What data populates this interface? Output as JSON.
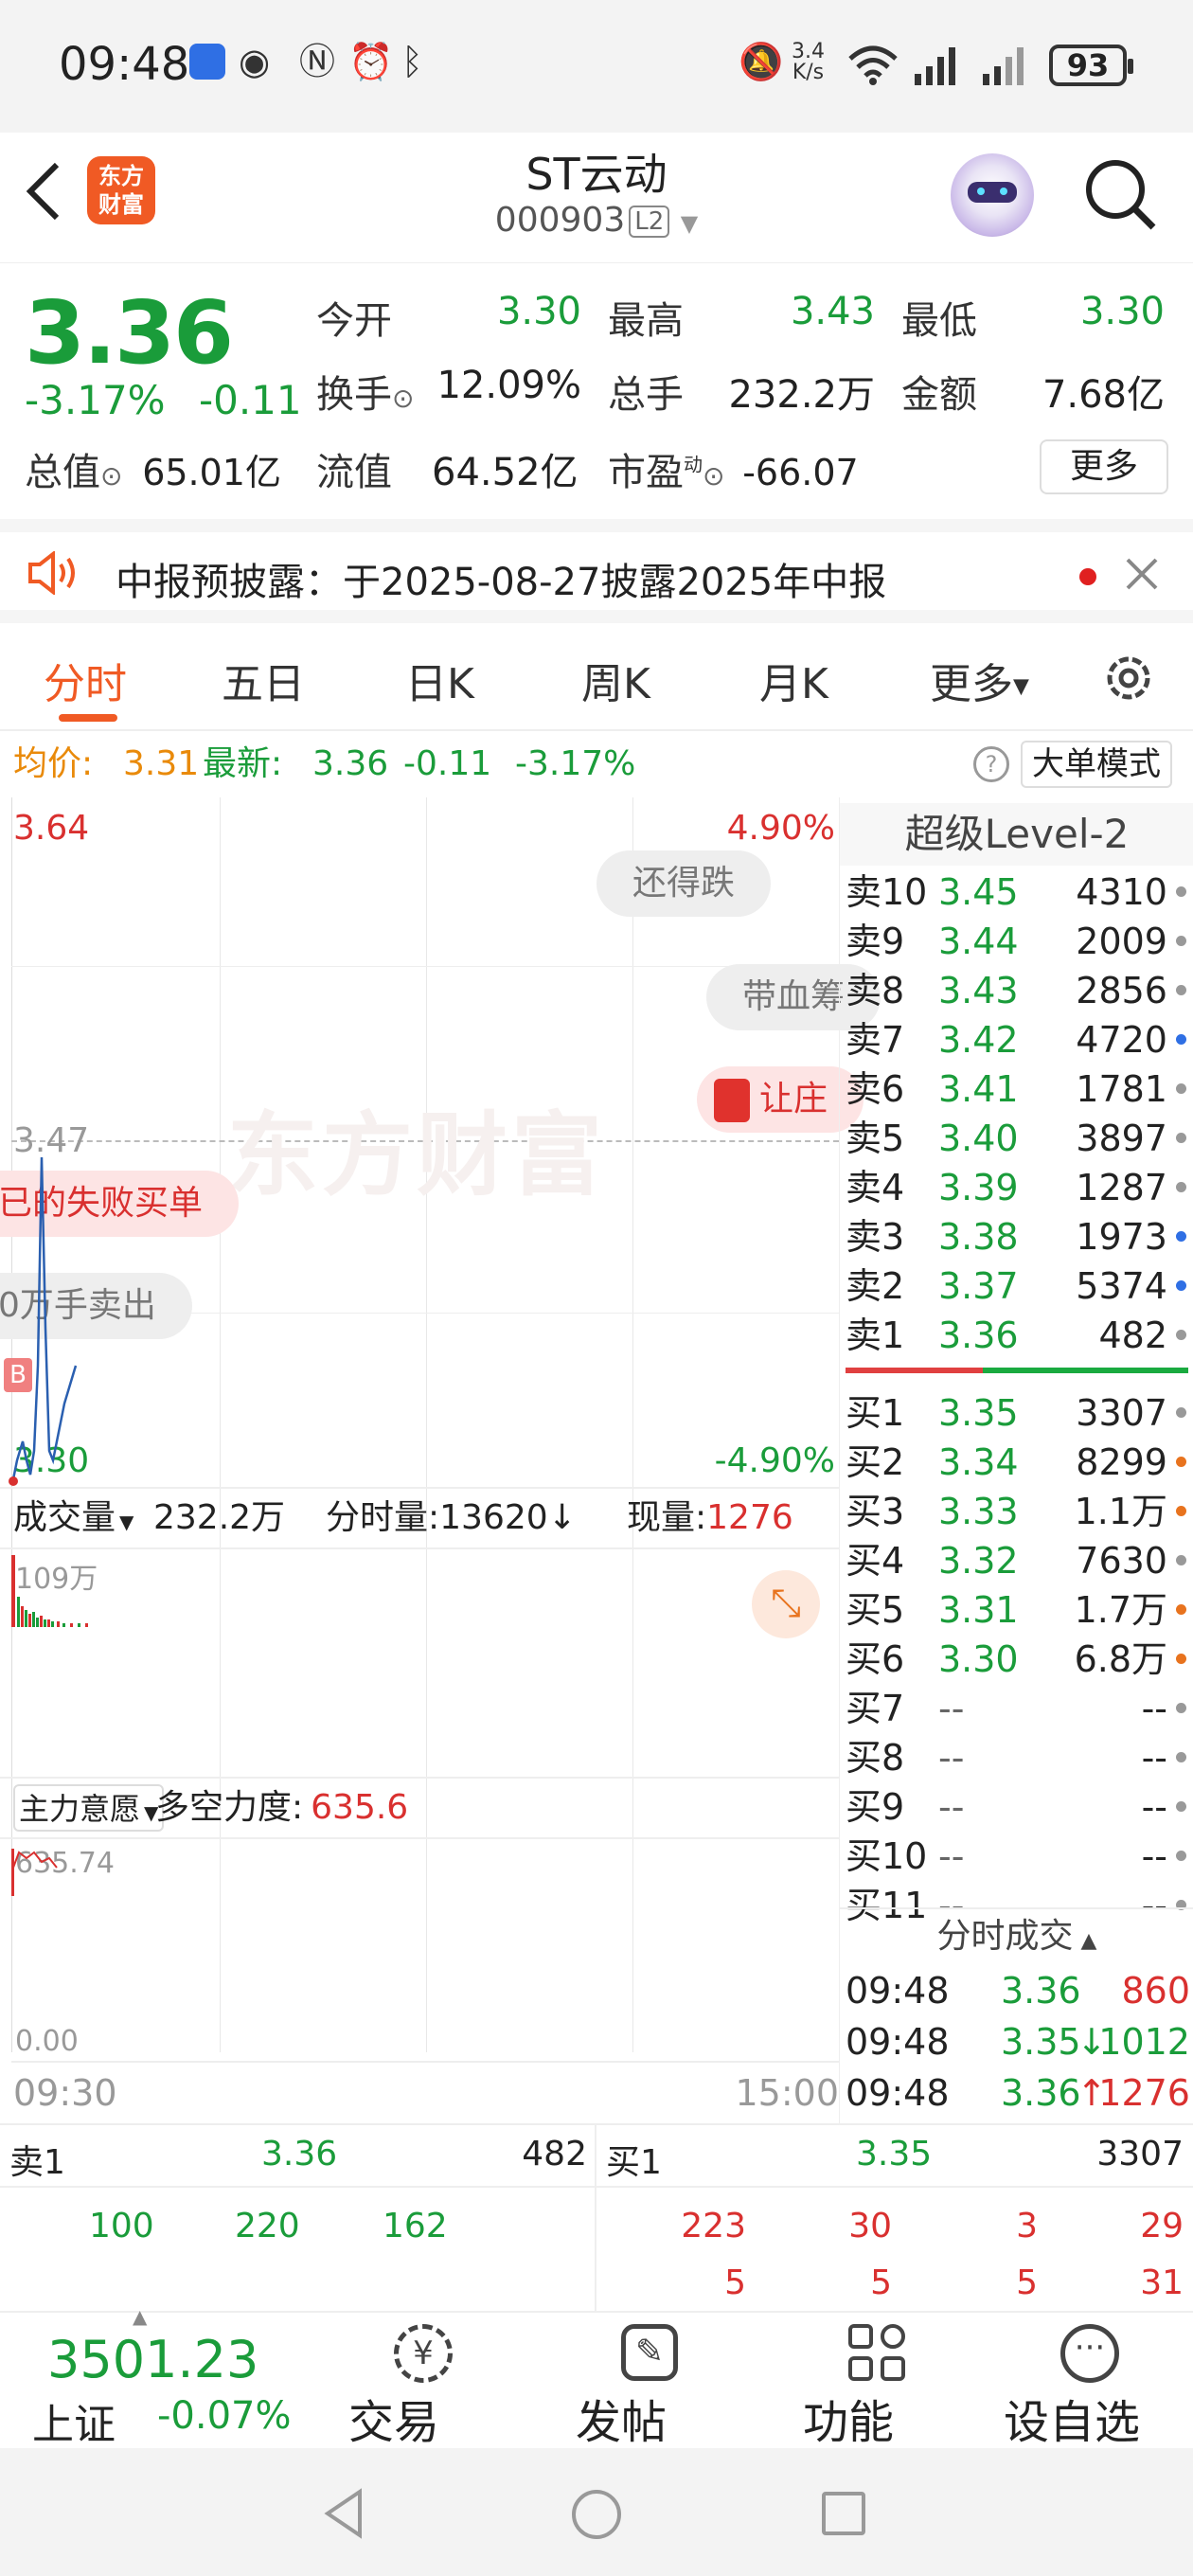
{
  "status_bar": {
    "time": "09:48",
    "net_speed_top": "3.4",
    "net_speed_bottom": "K/s",
    "battery": "93",
    "icons": [
      "app-icon",
      "eye-icon",
      "nfc-icon",
      "alarm-icon",
      "bluetooth-icon",
      "mute-icon",
      "wifi-icon",
      "signal-icon",
      "signal-icon"
    ]
  },
  "header": {
    "back_icon": "chevron-left-icon",
    "logo_line1": "东方",
    "logo_line2": "财富",
    "title": "ST云动",
    "code": "000903",
    "level_badge": "L2",
    "search_icon": "search-icon",
    "avatar_icon": "robot-avatar-icon"
  },
  "quote": {
    "price": "3.36",
    "change_pct": "-3.17%",
    "change": "-0.11",
    "open_label": "今开",
    "open": "3.30",
    "high_label": "最高",
    "high": "3.43",
    "low_label": "最低",
    "low": "3.30",
    "turnover_label": "换手",
    "turnover": "12.09%",
    "volume_label": "总手",
    "volume": "232.2万",
    "amount_label": "金额",
    "amount": "7.68亿",
    "mktcap_label": "总值",
    "mktcap": "65.01亿",
    "float_label": "流值",
    "float_cap": "64.52亿",
    "pe_label": "市盈",
    "pe_sup": "动",
    "pe": "-66.07",
    "more_button": "更多"
  },
  "notice": {
    "icon": "speaker-icon",
    "text": "中报预披露：于2025-08-27披露2025年中报",
    "close_icon": "close-icon"
  },
  "tabs": {
    "items": [
      "分时",
      "五日",
      "日K",
      "周K",
      "月K",
      "更多"
    ],
    "active": "分时",
    "settings_icon": "gear-icon"
  },
  "avg_bar": {
    "avg_label": "均价:",
    "avg": "3.31",
    "latest_label": "最新:",
    "latest": "3.36",
    "change": "-0.11",
    "change_pct": "-3.17%",
    "help_icon": "help-icon",
    "big_order_button": "大单模式"
  },
  "chart": {
    "price_top": "3.64",
    "pct_top": "4.90%",
    "price_mid": "3.47",
    "price_bottom": "3.30",
    "pct_bottom": "-4.90%",
    "watermark": "东方财富",
    "buy_marker": "B",
    "bubbles": [
      "还得跌",
      "带血筹",
      "让庄",
      "已的失败买单",
      "0万手卖出"
    ],
    "vol_selector": "成交量",
    "vol_total": "232.2万",
    "tick_vol_label": "分时量:",
    "tick_vol": "13620",
    "tick_vol_arrow": "↓",
    "cur_vol_label": "现量:",
    "cur_vol": "1276",
    "vol_axis_top": "109万",
    "expand_icon": "expand-icon",
    "indicator_selector": "主力意愿",
    "indicator_label": "多空力度:",
    "indicator_value": "635.6",
    "ind_axis_top": "635.74",
    "ind_axis_bottom": "0.00",
    "time_start": "09:30",
    "time_end": "15:00"
  },
  "order_book": {
    "title": "超级Level-2",
    "asks": [
      {
        "name": "卖10",
        "price": "3.45",
        "vol": "4310",
        "dot": "#999"
      },
      {
        "name": "卖9",
        "price": "3.44",
        "vol": "2009",
        "dot": "#999"
      },
      {
        "name": "卖8",
        "price": "3.43",
        "vol": "2856",
        "dot": "#999"
      },
      {
        "name": "卖7",
        "price": "3.42",
        "vol": "4720",
        "dot": "#2f6fe4"
      },
      {
        "name": "卖6",
        "price": "3.41",
        "vol": "1781",
        "dot": "#999"
      },
      {
        "name": "卖5",
        "price": "3.40",
        "vol": "3897",
        "dot": "#999"
      },
      {
        "name": "卖4",
        "price": "3.39",
        "vol": "1287",
        "dot": "#999"
      },
      {
        "name": "卖3",
        "price": "3.38",
        "vol": "1973",
        "dot": "#2f6fe4"
      },
      {
        "name": "卖2",
        "price": "3.37",
        "vol": "5374",
        "dot": "#2f6fe4"
      },
      {
        "name": "卖1",
        "price": "3.36",
        "vol": "482",
        "dot": "#999"
      }
    ],
    "bids": [
      {
        "name": "买1",
        "price": "3.35",
        "vol": "3307",
        "dot": "#999"
      },
      {
        "name": "买2",
        "price": "3.34",
        "vol": "8299",
        "dot": "#e8731e"
      },
      {
        "name": "买3",
        "price": "3.33",
        "vol": "1.1万",
        "dot": "#e8731e"
      },
      {
        "name": "买4",
        "price": "3.32",
        "vol": "7630",
        "dot": "#999"
      },
      {
        "name": "买5",
        "price": "3.31",
        "vol": "1.7万",
        "dot": "#e8731e"
      },
      {
        "name": "买6",
        "price": "3.30",
        "vol": "6.8万",
        "dot": "#e8731e"
      },
      {
        "name": "买7",
        "price": "--",
        "vol": "--",
        "dot": "#999"
      },
      {
        "name": "买8",
        "price": "--",
        "vol": "--",
        "dot": "#999"
      },
      {
        "name": "买9",
        "price": "--",
        "vol": "--",
        "dot": "#999"
      },
      {
        "name": "买10",
        "price": "--",
        "vol": "--",
        "dot": "#999"
      },
      {
        "name": "买11",
        "price": "--",
        "vol": "--",
        "dot": "#999"
      }
    ],
    "trades_title": "分时成交",
    "trades": [
      {
        "time": "09:48",
        "price": "3.36",
        "arrow": "",
        "vol": "860"
      },
      {
        "time": "09:48",
        "price": "3.35",
        "arrow": "↓",
        "vol": "1012"
      },
      {
        "time": "09:48",
        "price": "3.36",
        "arrow": "↑",
        "vol": "1276"
      }
    ]
  },
  "tick_detail": {
    "left_label": "卖1",
    "left_price": "3.36",
    "left_vol": "482",
    "right_label": "买1",
    "right_price": "3.35",
    "right_vol": "3307",
    "left_row": [
      "100",
      "220",
      "162"
    ],
    "right_row1": [
      "223",
      "30",
      "3",
      "29"
    ],
    "right_row2": [
      "5",
      "5",
      "5",
      "31"
    ]
  },
  "bottom_nav": {
    "index_value": "3501.23",
    "index_name": "上证",
    "index_change": "-0.07%",
    "items": [
      {
        "label": "交易",
        "icon": "yuan-exchange-icon"
      },
      {
        "label": "发帖",
        "icon": "edit-icon"
      },
      {
        "label": "功能",
        "icon": "grid-icon"
      },
      {
        "label": "设自选",
        "icon": "more-icon"
      }
    ]
  },
  "system_nav": {
    "icons": [
      "back-triangle-icon",
      "home-circle-icon",
      "recents-square-icon"
    ]
  }
}
